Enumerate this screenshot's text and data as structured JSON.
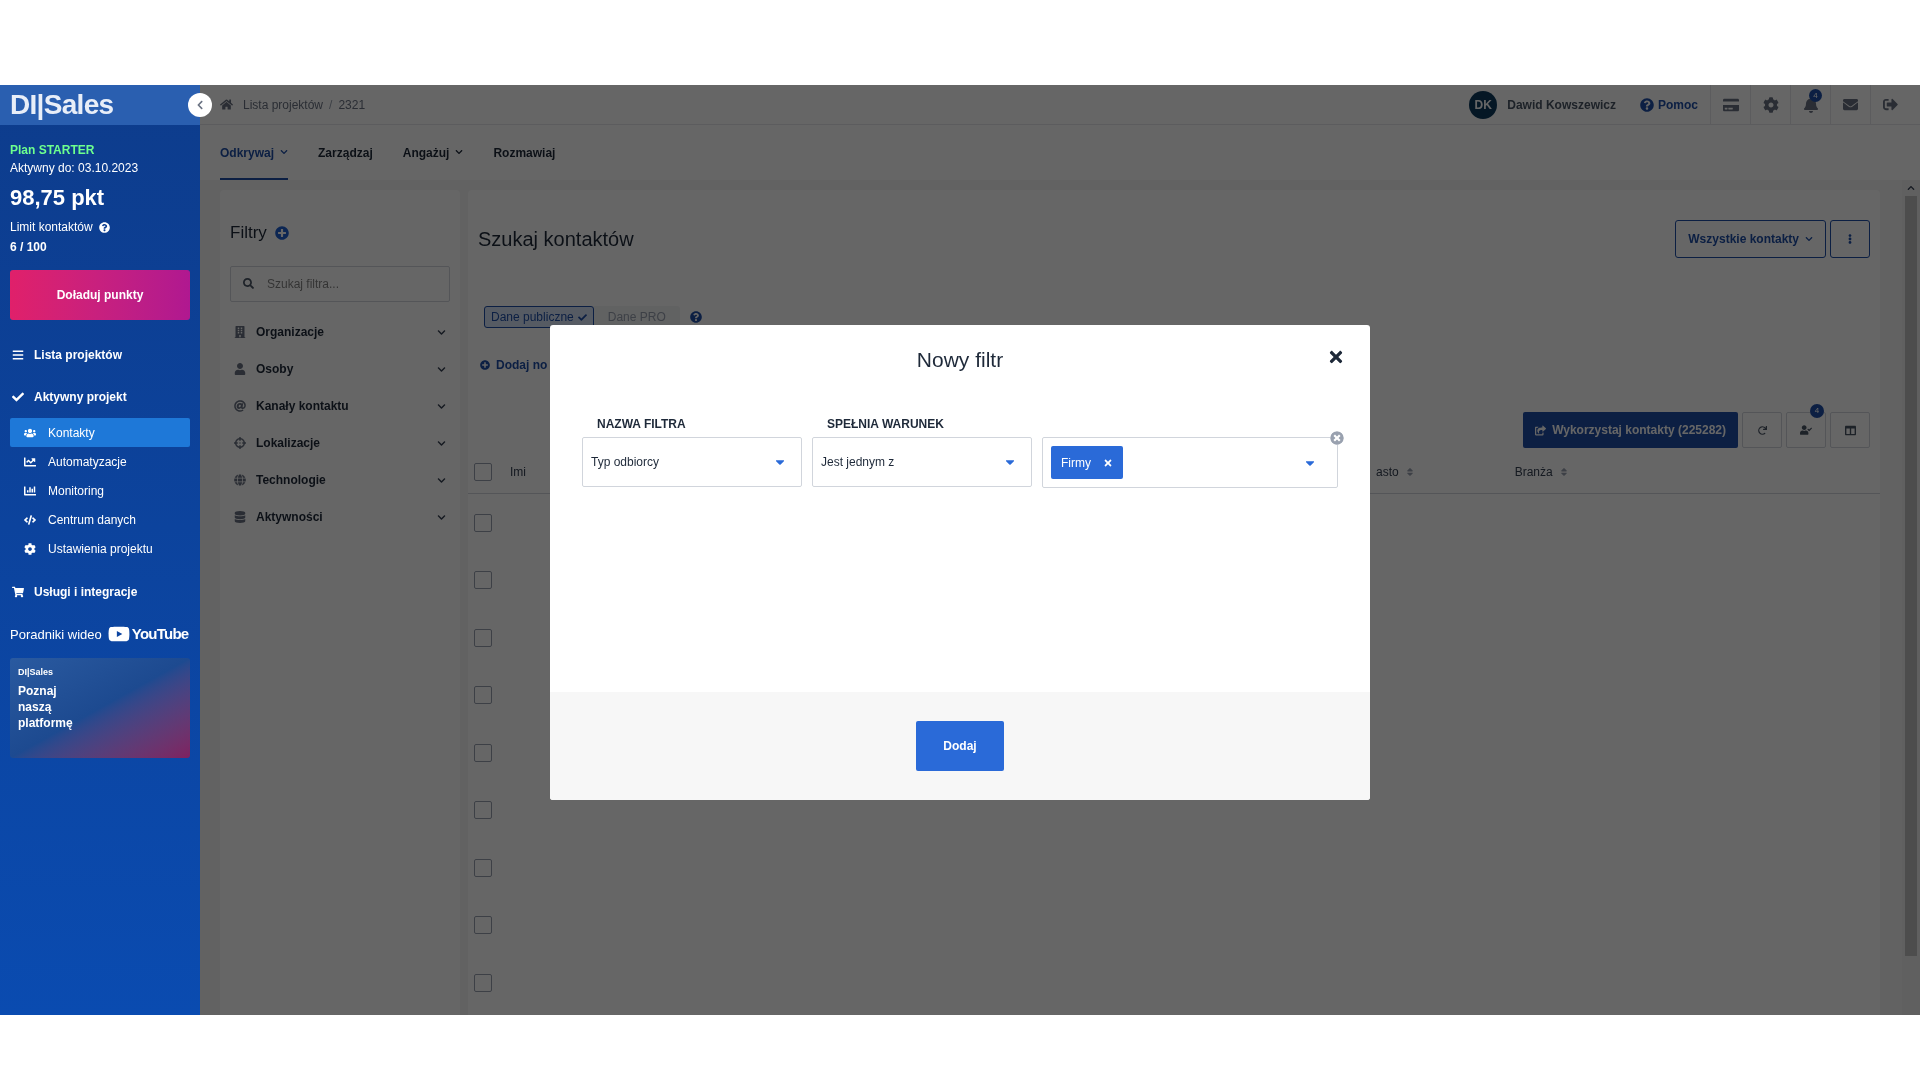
{
  "sidebar": {
    "logo": "DI|Sales",
    "plan": "Plan STARTER",
    "active_until": "Aktywny do: 03.10.2023",
    "points": "98,75 pkt",
    "limit_label": "Limit kontaktów",
    "limit_value": "6 / 100",
    "topup_button": "Doładuj punkty",
    "items": [
      {
        "label": "Lista projektów",
        "kind": "section",
        "selected": false
      },
      {
        "label": "Aktywny projekt",
        "kind": "section",
        "selected": false
      },
      {
        "label": "Kontakty",
        "kind": "sub",
        "selected": true
      },
      {
        "label": "Automatyzacje",
        "kind": "sub",
        "selected": false
      },
      {
        "label": "Monitoring",
        "kind": "sub",
        "selected": false
      },
      {
        "label": "Centrum danych",
        "kind": "sub",
        "selected": false
      },
      {
        "label": "Ustawienia projektu",
        "kind": "sub",
        "selected": false
      },
      {
        "label": "Usługi i integracje",
        "kind": "section",
        "selected": false
      }
    ],
    "video_label": "Poradniki wideo",
    "youtube": "YouTube",
    "promo": {
      "brand": "DI|Sales",
      "text": "Poznaj naszą platformę"
    }
  },
  "topbar": {
    "breadcrumb": [
      "Lista projektów",
      "2321"
    ],
    "breadcrumb_separator": "/",
    "user_initials": "DK",
    "user_name": "Dawid Kowszewicz",
    "help": "Pomoc",
    "notifications": "4"
  },
  "tabs": [
    {
      "label": "Odkrywaj",
      "dropdown": true,
      "selected": true
    },
    {
      "label": "Zarządzaj",
      "dropdown": false,
      "selected": false
    },
    {
      "label": "Angażuj",
      "dropdown": true,
      "selected": false
    },
    {
      "label": "Rozmawiaj",
      "dropdown": false,
      "selected": false
    }
  ],
  "filters": {
    "title": "Filtry",
    "search": {
      "placeholder": "Szukaj filtra..."
    },
    "groups": [
      "Organizacje",
      "Osoby",
      "Kanały kontaktu",
      "Lokalizacje",
      "Technologie",
      "Aktywności"
    ]
  },
  "main": {
    "title": "Szukaj kontaktów",
    "view_button": "Wszystkie kontakty",
    "data_toggle": [
      {
        "label": "Dane publiczne",
        "selected": true
      },
      {
        "label": "Dane PRO",
        "selected": false
      }
    ],
    "add_link": "Dodaj no",
    "use_button": "Wykorzystaj kontakty (225282)",
    "assigned_badge": "4",
    "table": {
      "columns": [
        "Imi",
        "asto",
        "Branża"
      ],
      "header_checked": false,
      "rows": [
        {
          "checked": false
        },
        {
          "checked": false
        },
        {
          "checked": false
        },
        {
          "checked": false
        },
        {
          "checked": false
        },
        {
          "checked": false
        },
        {
          "checked": false
        },
        {
          "checked": false
        },
        {
          "checked": false
        }
      ]
    }
  },
  "modal": {
    "title": "Nowy filtr",
    "fields": [
      {
        "label": "NAZWA FILTRA",
        "value": "Typ odbiorcy"
      },
      {
        "label": "SPEŁNIA WARUNEK",
        "value": "Jest jednym z"
      }
    ],
    "chips": [
      "Firmy"
    ],
    "submit": "Dodaj"
  }
}
